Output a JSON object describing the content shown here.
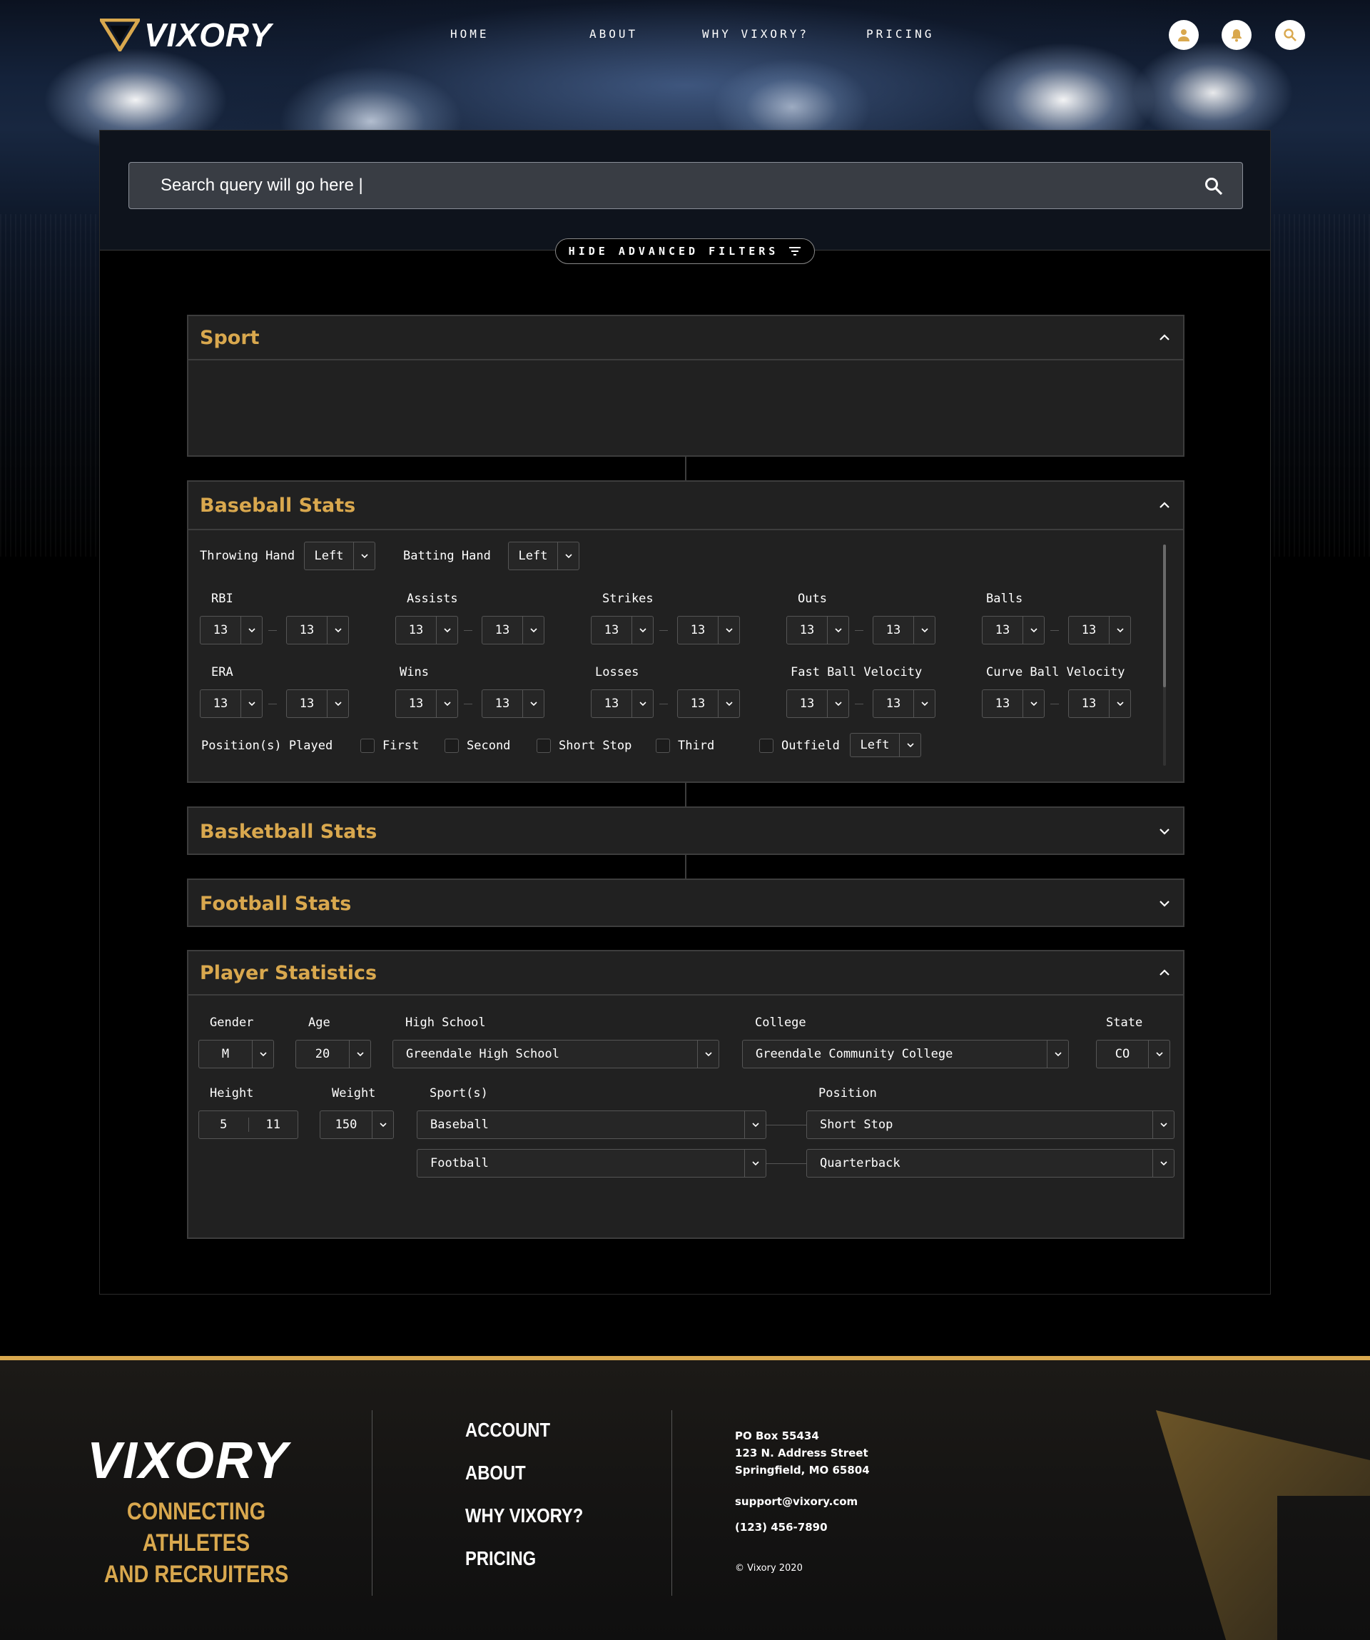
{
  "brand": {
    "name": "VIXORY"
  },
  "nav": {
    "items": [
      "HOME",
      "ABOUT",
      "WHY VIXORY?",
      "PRICING"
    ]
  },
  "header_icons": [
    "user-icon",
    "bell-icon",
    "search-icon"
  ],
  "search": {
    "query": "Search query will go here |"
  },
  "filters_toggle": {
    "label": "HIDE ADVANCED FILTERS"
  },
  "sections": {
    "sport": {
      "title": "Sport"
    },
    "baseball": {
      "title": "Baseball Stats",
      "throwing_hand_label": "Throwing Hand",
      "throwing_hand_value": "Left",
      "batting_hand_label": "Batting Hand",
      "batting_hand_value": "Left",
      "stats": [
        {
          "label": "RBI",
          "min": "13",
          "max": "13"
        },
        {
          "label": "Assists",
          "min": "13",
          "max": "13"
        },
        {
          "label": "Strikes",
          "min": "13",
          "max": "13"
        },
        {
          "label": "Outs",
          "min": "13",
          "max": "13"
        },
        {
          "label": "Balls",
          "min": "13",
          "max": "13"
        },
        {
          "label": "ERA",
          "min": "13",
          "max": "13"
        },
        {
          "label": "Wins",
          "min": "13",
          "max": "13"
        },
        {
          "label": "Losses",
          "min": "13",
          "max": "13"
        },
        {
          "label": "Fast Ball Velocity",
          "min": "13",
          "max": "13"
        },
        {
          "label": "Curve Ball Velocity",
          "min": "13",
          "max": "13"
        }
      ],
      "positions_label": "Position(s) Played",
      "positions": [
        "First",
        "Second",
        "Short Stop",
        "Third",
        "Outfield"
      ],
      "outfield_value": "Left"
    },
    "basketball": {
      "title": "Basketball Stats"
    },
    "football": {
      "title": "Football Stats"
    },
    "player": {
      "title": "Player Statistics",
      "gender_label": "Gender",
      "gender_value": "M",
      "age_label": "Age",
      "age_value": "20",
      "high_school_label": "High School",
      "high_school_value": "Greendale High School",
      "college_label": "College",
      "college_value": "Greendale Community College",
      "state_label": "State",
      "state_value": "CO",
      "height_label": "Height",
      "height_ft": "5",
      "height_in": "11",
      "weight_label": "Weight",
      "weight_value": "150",
      "sports_label": "Sport(s)",
      "position_label": "Position",
      "sport_rows": [
        {
          "sport": "Baseball",
          "position": "Short Stop"
        },
        {
          "sport": "Football",
          "position": "Quarterback"
        }
      ]
    }
  },
  "footer": {
    "logo": "VIXORY",
    "tagline_1": "CONNECTING ATHLETES",
    "tagline_2": "AND RECRUITERS",
    "links": [
      "ACCOUNT",
      "ABOUT",
      "WHY VIXORY?",
      "PRICING"
    ],
    "address_1": "PO Box 55434",
    "address_2": "123 N. Address Street",
    "address_3": "Springfield, MO 65804",
    "email": "support@vixory.com",
    "phone": "(123) 456-7890",
    "copyright": "© Vixory 2020"
  },
  "colors": {
    "accent": "#d9a84e",
    "panel": "#212121",
    "border": "#3d3d3d",
    "background": "#000000"
  }
}
